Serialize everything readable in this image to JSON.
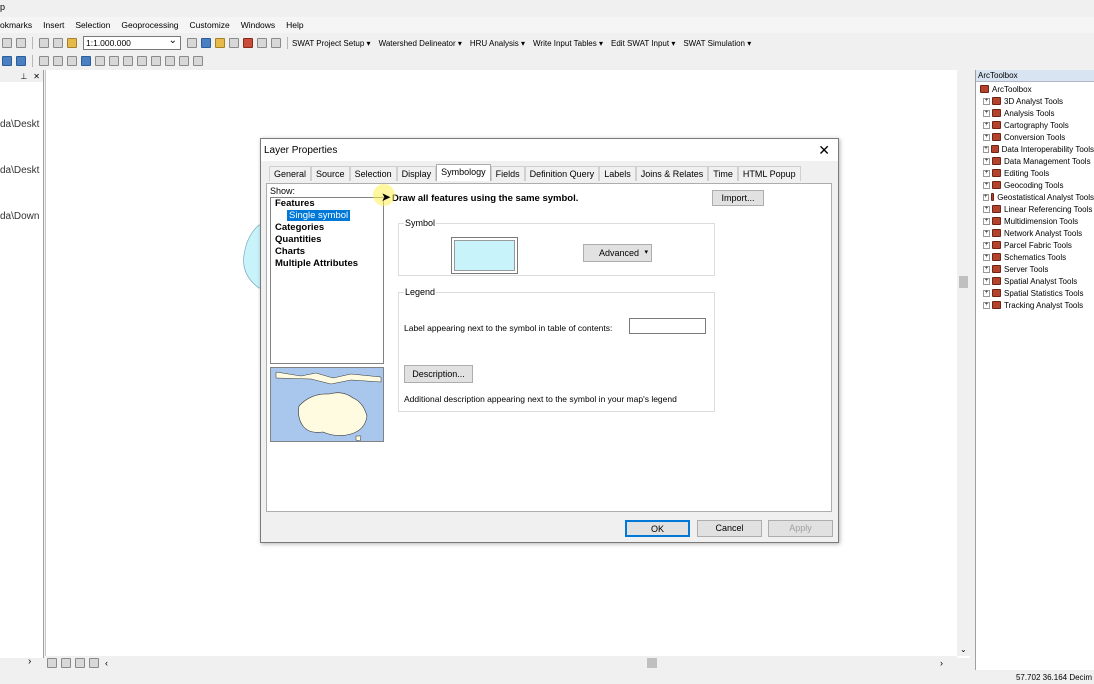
{
  "app": {
    "title_fragment": "p"
  },
  "menubar": [
    "okmarks",
    "Insert",
    "Selection",
    "Geoprocessing",
    "Customize",
    "Windows",
    "Help"
  ],
  "toolbar1": {
    "scale_value": "1:1.000.000",
    "items": [
      "SWAT Project Setup ▾",
      "Watershed Delineator ▾",
      "HRU Analysis ▾",
      "Write Input Tables ▾",
      "Edit SWAT Input ▾",
      "SWAT Simulation ▾"
    ]
  },
  "left_panel": {
    "header": [
      "⊥",
      "✕"
    ],
    "items": [
      "da\\Deskt",
      "da\\Deskt",
      "da\\Down"
    ]
  },
  "toolbox": {
    "title": "ArcToolbox",
    "root": "ArcToolbox",
    "items": [
      "3D Analyst Tools",
      "Analysis Tools",
      "Cartography Tools",
      "Conversion Tools",
      "Data Interoperability Tools",
      "Data Management Tools",
      "Editing Tools",
      "Geocoding Tools",
      "Geostatistical Analyst Tools",
      "Linear Referencing Tools",
      "Multidimension Tools",
      "Network Analyst Tools",
      "Parcel Fabric Tools",
      "Schematics Tools",
      "Server Tools",
      "Spatial Analyst Tools",
      "Spatial Statistics Tools",
      "Tracking Analyst Tools"
    ]
  },
  "status": {
    "coords": "57.702  36.164 Decim"
  },
  "dialog": {
    "title": "Layer Properties",
    "close": "✕",
    "tabs": [
      "General",
      "Source",
      "Selection",
      "Display",
      "Symbology",
      "Fields",
      "Definition Query",
      "Labels",
      "Joins & Relates",
      "Time",
      "HTML Popup"
    ],
    "active_tab": "Symbology",
    "show_label": "Show:",
    "show_list": {
      "features": "Features",
      "single_symbol": "Single symbol",
      "categories": "Categories",
      "quantities": "Quantities",
      "charts": "Charts",
      "multiple_attributes": "Multiple Attributes"
    },
    "draw_all": "Draw all features using the same symbol.",
    "import_btn": "Import...",
    "symbol_group": "Symbol",
    "advanced_btn": "Advanced",
    "legend_group": "Legend",
    "legend_label": "Label appearing next to the symbol in table of contents:",
    "legend_value": "",
    "description_btn": "Description...",
    "description_text": "Additional description appearing next to the symbol in your map's legend",
    "ok": "OK",
    "cancel": "Cancel",
    "apply": "Apply"
  },
  "colors": {
    "symbol_fill": "#c8f3fb",
    "selection": "#0078d7",
    "preview_water": "#a9c7ec",
    "preview_land": "#fffbe0"
  }
}
